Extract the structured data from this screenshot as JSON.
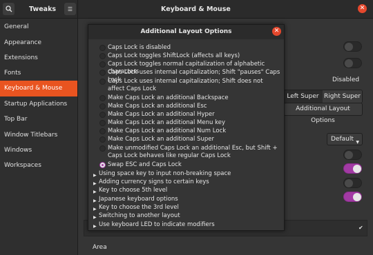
{
  "app": {
    "title": "Tweaks",
    "window_title": "Keyboard & Mouse",
    "close_glyph": "✕",
    "menu_glyph": "☰"
  },
  "sidebar": {
    "items": [
      {
        "label": "General",
        "active": false
      },
      {
        "label": "Appearance",
        "active": false
      },
      {
        "label": "Extensions",
        "active": false
      },
      {
        "label": "Fonts",
        "active": false
      },
      {
        "label": "Keyboard & Mouse",
        "active": true
      },
      {
        "label": "Startup Applications",
        "active": false
      },
      {
        "label": "Top Bar",
        "active": false
      },
      {
        "label": "Window Titlebars",
        "active": false
      },
      {
        "label": "Windows",
        "active": false
      },
      {
        "label": "Workspaces",
        "active": false
      }
    ]
  },
  "main": {
    "disabled_label": "Disabled",
    "left_super": "Left Super",
    "right_super": "Right Super",
    "additional_layout_options": "Additional Layout Options",
    "default_label": "Default",
    "area_label": "Area",
    "check_glyph": "✔"
  },
  "dialog": {
    "title": "Additional Layout Options",
    "close_glyph": "✕",
    "options": [
      {
        "label": "Caps Lock is disabled",
        "selected": false
      },
      {
        "label": "Caps Lock toggles ShiftLock (affects all keys)",
        "selected": false
      },
      {
        "label": "Caps Lock toggles normal capitalization of alphabetic characters",
        "selected": false
      },
      {
        "label": "Caps Lock uses internal capitalization; Shift \"pauses\" Caps Lock",
        "selected": false
      },
      {
        "label": "Caps Lock uses internal capitalization; Shift does not affect Caps Lock",
        "selected": false
      },
      {
        "label": "Make Caps Lock an additional Backspace",
        "selected": false
      },
      {
        "label": "Make Caps Lock an additional Esc",
        "selected": false
      },
      {
        "label": "Make Caps Lock an additional Hyper",
        "selected": false
      },
      {
        "label": "Make Caps Lock an additional Menu key",
        "selected": false
      },
      {
        "label": "Make Caps Lock an additional Num Lock",
        "selected": false
      },
      {
        "label": "Make Caps Lock an additional Super",
        "selected": false
      },
      {
        "label": "Make unmodified Caps Lock an additional Esc, but Shift + Caps Lock behaves like regular Caps Lock",
        "selected": false
      },
      {
        "label": "Swap ESC and Caps Lock",
        "selected": true
      }
    ],
    "sections": [
      "Using space key to input non-breaking space",
      "Adding currency signs to certain keys",
      "Key to choose 5th level",
      "Japanese keyboard options",
      "Key to choose the 3rd level",
      "Switching to another layout",
      "Use keyboard LED to indicate modifiers"
    ]
  }
}
